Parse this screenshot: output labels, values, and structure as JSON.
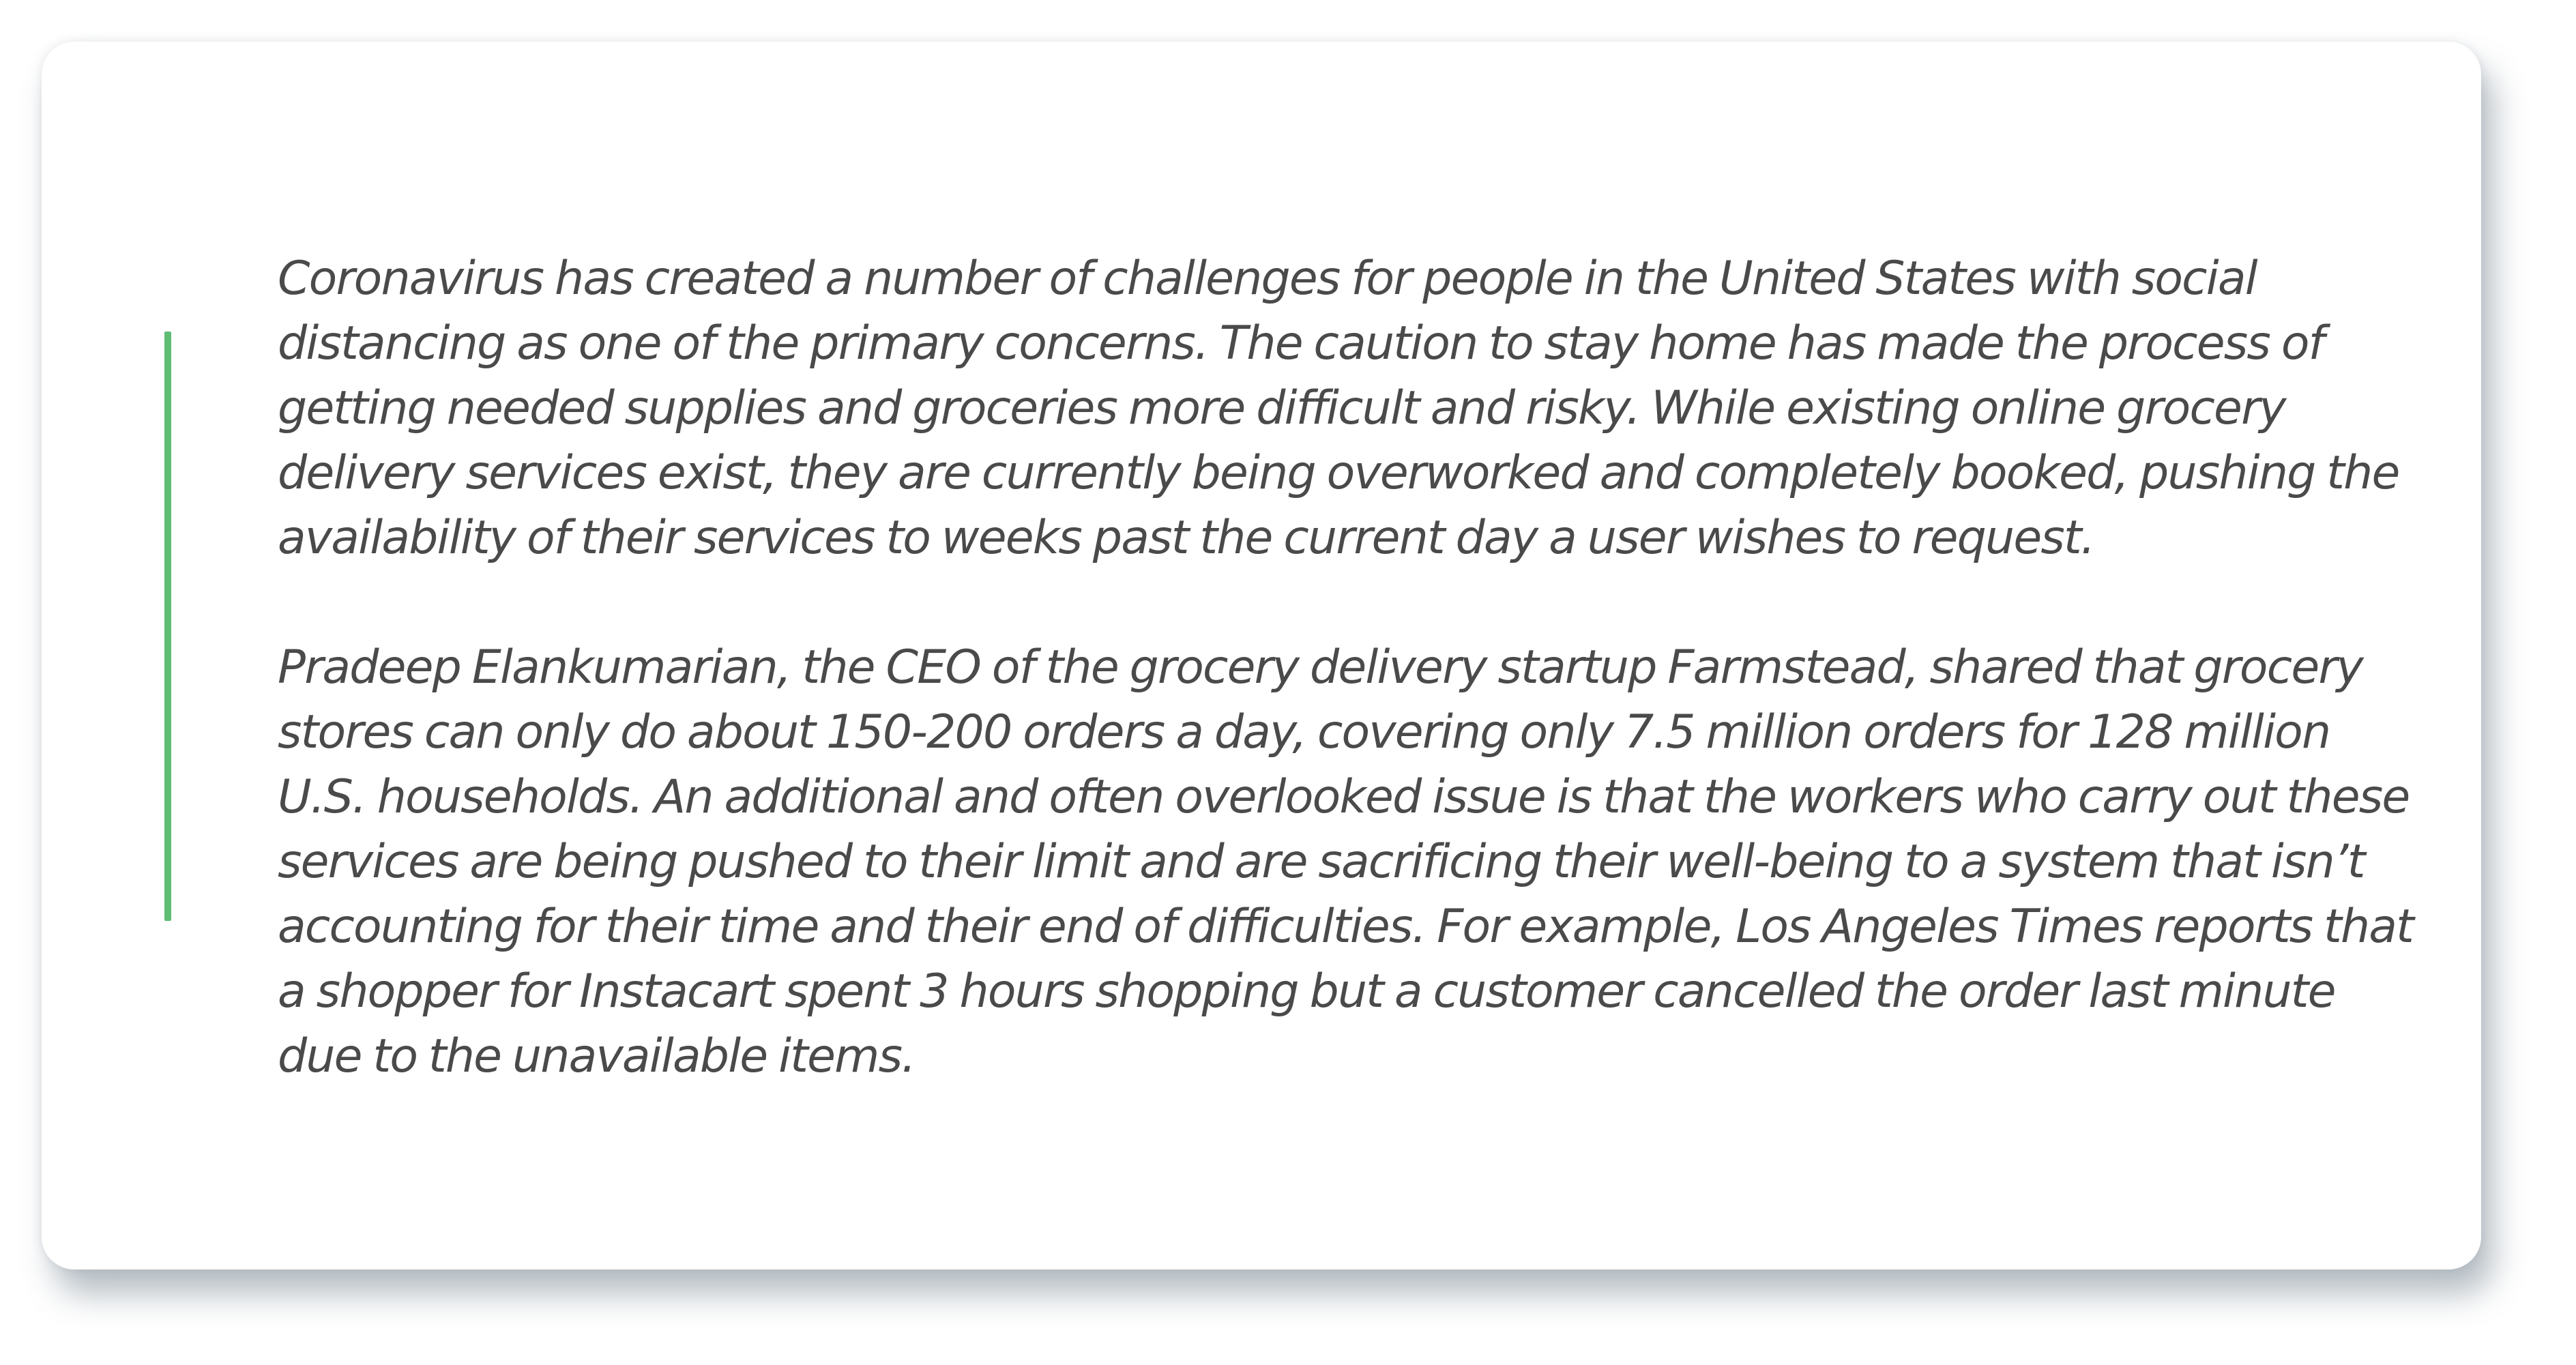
{
  "article": {
    "paragraphs": [
      "Coronavirus has created a number of challenges for people in the United States with social distancing as one of the primary concerns. The caution to stay home has made the process of getting needed supplies and groceries more difficult and risky. While existing online grocery delivery services exist, they are currently being overworked and completely booked, pushing the availability of their services to weeks past the current day a user wishes to request.",
      "Pradeep Elankumarian, the CEO of the grocery delivery startup Farmstead, shared that grocery stores can only do about 150-200 orders a day, covering only 7.5 million orders for 128 million U.S. households. An additional and often overlooked issue is that the workers who carry out these services are being pushed to their limit and are sacrificing their well-being to a system that isn’t accounting for their time and their end of difficulties. For example, Los Angeles Times reports that a shopper for Instacart spent 3 hours shopping but a customer cancelled the order last minute due to the unavailable items."
    ]
  },
  "colors": {
    "accent": "#5ebd73",
    "text": "#4a4a4a",
    "card": "#ffffff"
  }
}
